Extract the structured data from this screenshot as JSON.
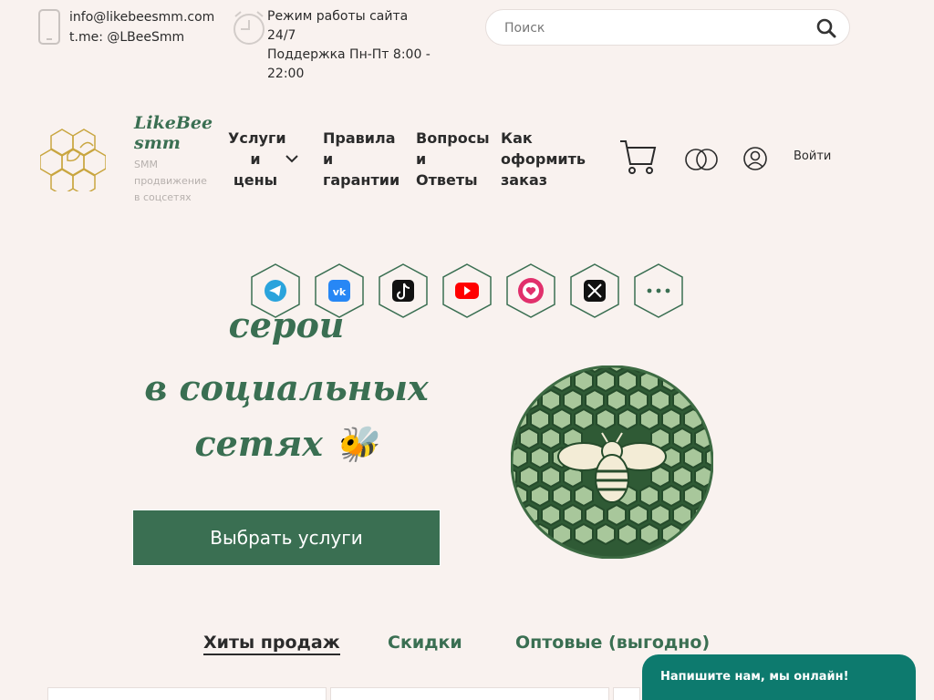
{
  "topbar": {
    "email": "info@likebeesmm.com",
    "telegram": "t.me: @LBeeSmm",
    "hours_line1": "Режим работы сайта 24/7",
    "hours_line2": "Поддержка Пн-Пт 8:00 - 22:00",
    "search_placeholder": "Поиск"
  },
  "header": {
    "brand": "LikeBee smm",
    "tagline": "SMM продвижение в соцсетях",
    "nav": [
      {
        "label": "Услуги и цены"
      },
      {
        "label": "Правила и гарантии"
      },
      {
        "label": "Вопросы и Ответы"
      },
      {
        "label": "Как оформить заказ"
      }
    ],
    "login": "Войти"
  },
  "socials": [
    "telegram-icon",
    "vk-icon",
    "tiktok-icon",
    "youtube-icon",
    "instagram-icon",
    "x-icon",
    "more-icon"
  ],
  "hero": {
    "line_partial": "серой раскрутки",
    "line2": "в социальных",
    "line3": "сетях 🐝",
    "cta": "Выбрать услуги"
  },
  "tabs": [
    {
      "label": "Хиты продаж",
      "active": true
    },
    {
      "label": "Скидки",
      "active": false
    },
    {
      "label": "Оптовые (выгодно)",
      "active": false
    }
  ],
  "chat": {
    "label": "Напишите нам, мы онлайн!"
  },
  "colors": {
    "accent": "#3a6f52",
    "background": "#f9f2ef",
    "chat": "#0d7a6e"
  }
}
